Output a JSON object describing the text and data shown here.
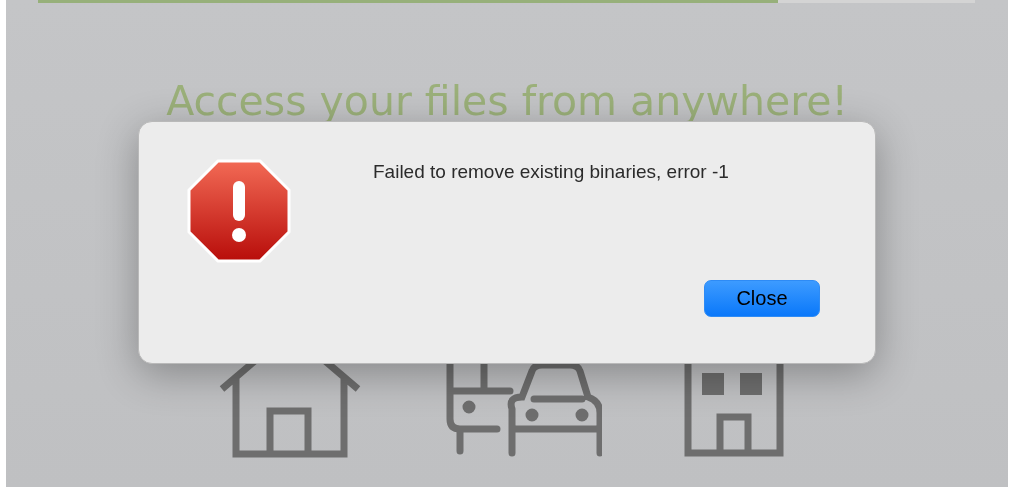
{
  "background": {
    "progress": {
      "level": 0.79
    },
    "heading": "Access your files from anywhere!"
  },
  "dialog": {
    "message": "Failed to remove existing binaries, error -1",
    "buttons": [
      {
        "label": "Close",
        "default": true
      }
    ]
  }
}
